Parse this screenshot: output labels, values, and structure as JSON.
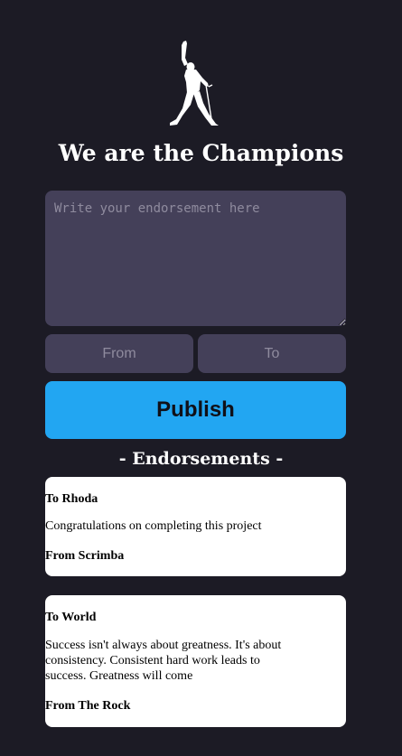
{
  "header": {
    "logo_icon": "freddie-mercury-silhouette-icon",
    "title": "We are the Champions"
  },
  "form": {
    "endorsement_placeholder": "Write your endorsement here",
    "endorsement_value": "",
    "from_placeholder": "From",
    "from_value": "",
    "to_placeholder": "To",
    "to_value": "",
    "publish_label": "Publish"
  },
  "endorsements": {
    "heading": "- Endorsements -",
    "items": [
      {
        "to": "To Rhoda",
        "message": "Congratulations on completing this project",
        "from": "From Scrimba"
      },
      {
        "to": "To World",
        "message": "Success isn't always about greatness. It's about consistency. Consistent hard work leads to success. Greatness will come",
        "from": "From The Rock"
      }
    ]
  },
  "colors": {
    "background": "#1c1b25",
    "input_background": "#444059",
    "accent": "#22a6f2",
    "card_background": "#ffffff"
  }
}
